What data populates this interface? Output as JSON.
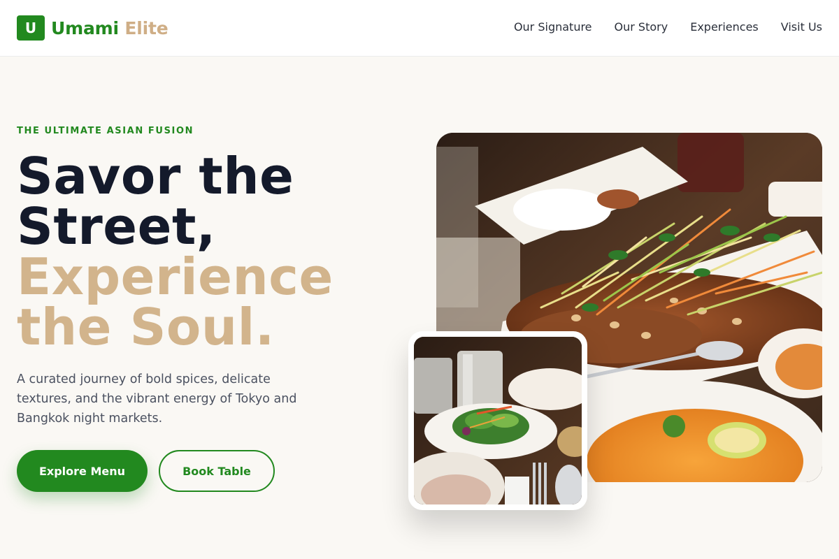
{
  "brand": {
    "mark": "U",
    "name_primary": "Umami",
    "name_secondary": "Elite",
    "primary_color": "#22891f",
    "secondary_color": "#cfae86"
  },
  "nav": {
    "items": [
      {
        "label": "Our Signature"
      },
      {
        "label": "Our Story"
      },
      {
        "label": "Experiences"
      },
      {
        "label": "Visit Us"
      }
    ]
  },
  "hero": {
    "eyebrow": "THE ULTIMATE ASIAN FUSION",
    "headline_line1": "Savor the",
    "headline_line2": "Street,",
    "headline_line3": "Experience",
    "headline_line4": "the Soul.",
    "description": "A curated journey of bold spices, delicate textures, and the vibrant energy of Tokyo and Bangkok night markets.",
    "primary_button": "Explore Menu",
    "secondary_button": "Book Table"
  },
  "images": {
    "main_photo": "food-photo-salad-platter",
    "small_photo": "food-photo-salad-plate"
  }
}
